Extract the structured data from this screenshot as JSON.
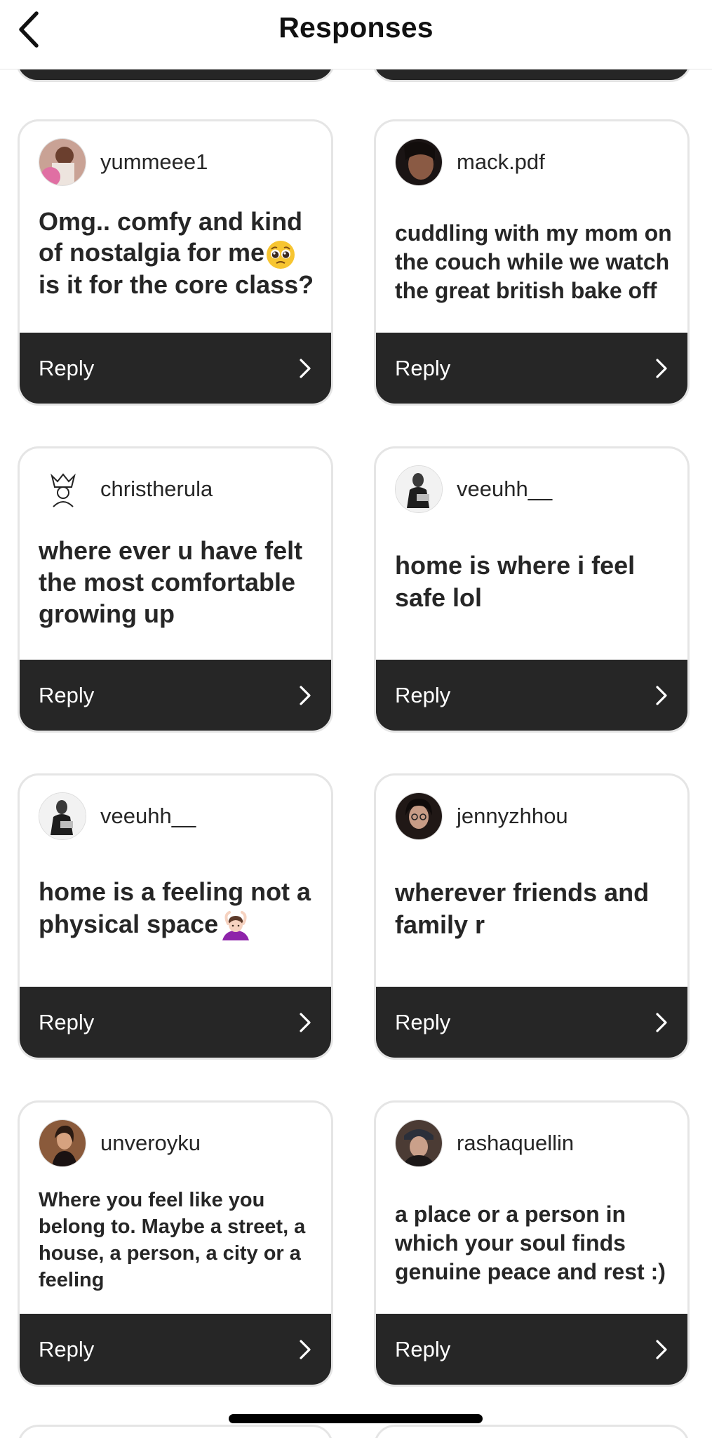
{
  "header": {
    "title": "Responses",
    "back_icon": "chevron-left-icon"
  },
  "reply_label": "Reply",
  "responses": [
    {
      "username": "yummeee1",
      "text": "Omg.. comfy and kind of nostalgia for me",
      "emoji": "pleading-face-emoji",
      "text_after": " is it for the core class?",
      "avatar_color": "#b9867a"
    },
    {
      "username": "mack.pdf",
      "text": "cuddling with my mom on the couch while we watch the great british bake off",
      "avatar_color": "#3a2a24"
    },
    {
      "username": "christherula",
      "text": "where ever u have felt the most comfortable growing up",
      "avatar_color": "#f4f4f4"
    },
    {
      "username": "veeuhh__",
      "text": "home is where i feel safe lol",
      "avatar_color": "#e9e9e9"
    },
    {
      "username": "veeuhh__",
      "text": "home is a feeling not a physical space",
      "emoji": "person-gesturing-ok-emoji",
      "avatar_color": "#e9e9e9"
    },
    {
      "username": "jennyzhhou",
      "text": "wherever friends and family r",
      "avatar_color": "#2c221f"
    },
    {
      "username": "unveroyku",
      "text": "Where you feel like you belong to. Maybe a street, a house, a person, a city or a feeling",
      "avatar_color": "#7a4e33"
    },
    {
      "username": "rashaquellin",
      "text": "a place or a person in which your soul finds genuine peace and rest :)",
      "avatar_color": "#4b3b34"
    }
  ],
  "colors": {
    "reply_bar": "#262626",
    "card_border": "#e5e5e5",
    "text": "#262626"
  }
}
